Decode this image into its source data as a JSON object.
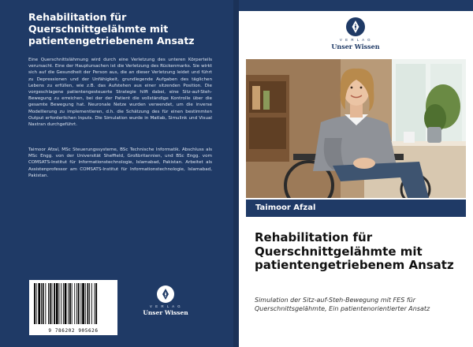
{
  "back": {
    "title": "Rehabilitation für Querschnittgelähmte mit patientengetriebenem Ansatz",
    "abstract": "Eine Querschnittslähmung wird durch eine Verletzung des unteren Körperteils verursacht. Eine der Hauptursachen ist die Verletzung des Rückenmarks. Sie wirkt sich auf die Gesundheit der Person aus, die an dieser Verletzung leidet und führt zu Depressionen und der Unfähigkeit, grundlegende Aufgaben des täglichen Lebens zu erfüllen, wie z.B. das Aufstehen aus einer sitzenden Position. Die vorgeschlagene patientengesteuerte Strategie hilft dabei, eine Sitz-auf-Steh-Bewegung zu erreichen, bei der der Patient die vollständige Kontrolle über die gesamte Bewegung hat. Neuronale Netze wurden verwendet, um die inverse Modellierung zu implementieren, d.h. die Schätzung des für einen bestimmten Output erforderlichen Inputs. Die Simulation wurde in Matlab, Simulink und Visual Nastran durchgeführt.",
    "bio": "Taimoor Afzal, MSc Steuerungssysteme, BSc Technische Informatik. Abschluss als MSc Engg. von der Universität Sheffield, Großbritannien, und BSc Engg. vom COMSATS-Institut für Informationstechnologie, Islamabad, Pakistan. Arbeitet als Assistenprofessor am COMSATS-Institut für Informationstechnologie, Islamabad, Pakistan.",
    "barcode_digits": "9 786202 905626",
    "publisher_verlag": "V E R L A G",
    "publisher_name": "Unser Wissen"
  },
  "front": {
    "publisher_verlag": "V E R L A G",
    "publisher_name": "Unser Wissen",
    "author": "Taimoor Afzal",
    "title": "Rehabilitation für Querschnittgelähmte mit patientengetriebenem Ansatz",
    "subtitle": "Simulation der Sitz-auf-Steh-Bewegung mit FES für Querschnittsgelähmte, Ein patientenorientierter Ansatz"
  },
  "colors": {
    "navy": "#1f3a66",
    "spine": "#1b3258",
    "white": "#ffffff"
  },
  "icons": {
    "publisher_logo": "pen-nib-icon",
    "barcode": "barcode-icon"
  }
}
